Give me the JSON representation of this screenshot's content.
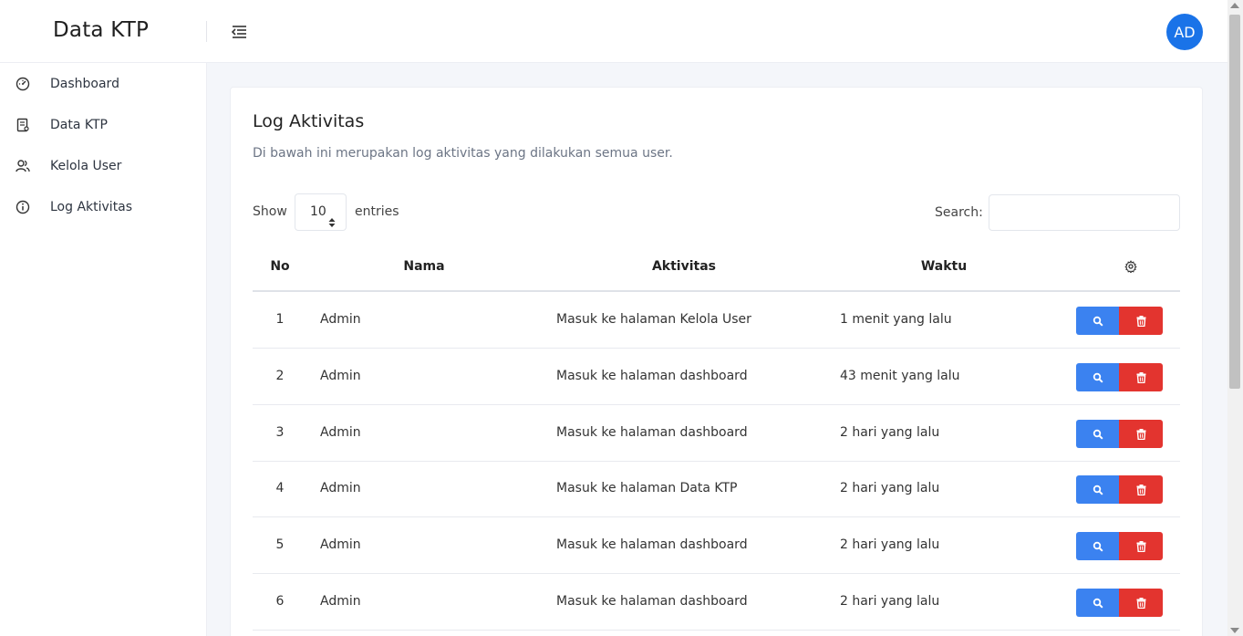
{
  "brand": {
    "title": "Data KTP"
  },
  "user": {
    "initials": "AD"
  },
  "sidebar": {
    "items": [
      {
        "label": "Dashboard",
        "icon": "dashboard-icon"
      },
      {
        "label": "Data KTP",
        "icon": "document-icon"
      },
      {
        "label": "Kelola User",
        "icon": "users-icon"
      },
      {
        "label": "Log Aktivitas",
        "icon": "info-icon"
      }
    ]
  },
  "page": {
    "title": "Log Aktivitas",
    "description": "Di bawah ini merupakan log aktivitas yang dilakukan semua user."
  },
  "table_controls": {
    "show_label": "Show",
    "length_value": "10",
    "entries_label": "entries",
    "search_label": "Search:",
    "search_value": ""
  },
  "table": {
    "headers": {
      "no": "No",
      "nama": "Nama",
      "aktivitas": "Aktivitas",
      "waktu": "Waktu",
      "actions_icon": "gear-icon"
    },
    "rows": [
      {
        "no": "1",
        "nama": "Admin",
        "aktivitas": "Masuk ke halaman Kelola User",
        "waktu": "1 menit yang lalu"
      },
      {
        "no": "2",
        "nama": "Admin",
        "aktivitas": "Masuk ke halaman dashboard",
        "waktu": "43 menit yang lalu"
      },
      {
        "no": "3",
        "nama": "Admin",
        "aktivitas": "Masuk ke halaman dashboard",
        "waktu": "2 hari yang lalu"
      },
      {
        "no": "4",
        "nama": "Admin",
        "aktivitas": "Masuk ke halaman Data KTP",
        "waktu": "2 hari yang lalu"
      },
      {
        "no": "5",
        "nama": "Admin",
        "aktivitas": "Masuk ke halaman dashboard",
        "waktu": "2 hari yang lalu"
      },
      {
        "no": "6",
        "nama": "Admin",
        "aktivitas": "Masuk ke halaman dashboard",
        "waktu": "2 hari yang lalu"
      }
    ]
  },
  "colors": {
    "accent": "#1a73e8",
    "view_button": "#3b82f0",
    "delete_button": "#e3342f"
  }
}
